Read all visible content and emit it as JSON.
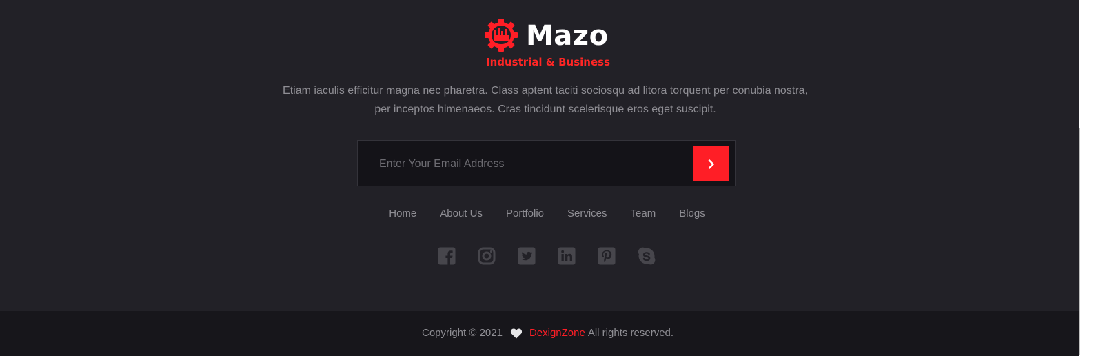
{
  "brand": {
    "name": "Mazo",
    "tagline": "Industrial & Business"
  },
  "description": "Etiam iaculis efficitur magna nec pharetra. Class aptent taciti sociosqu ad litora torquent per conubia nostra, per inceptos himenaeos. Cras tincidunt scelerisque eros eget suscipit.",
  "newsletter": {
    "placeholder": "Enter Your Email Address",
    "value": "",
    "submit_icon": "chevron-right-icon"
  },
  "nav": {
    "items": [
      {
        "label": "Home"
      },
      {
        "label": "About Us"
      },
      {
        "label": "Portfolio"
      },
      {
        "label": "Services"
      },
      {
        "label": "Team"
      },
      {
        "label": "Blogs"
      }
    ]
  },
  "social": [
    "facebook-icon",
    "instagram-icon",
    "twitter-icon",
    "linkedin-icon",
    "pinterest-icon",
    "skype-icon"
  ],
  "footer": {
    "copyright": "Copyright © 2021",
    "heart_icon": "heart-icon",
    "brand_link": "DexignZone",
    "rights": "All rights reserved."
  },
  "colors": {
    "accent": "#ff1e26",
    "background": "#222127",
    "bottom_bar": "#17161b",
    "text_muted": "#8f8e94",
    "input_bg": "#141318"
  }
}
